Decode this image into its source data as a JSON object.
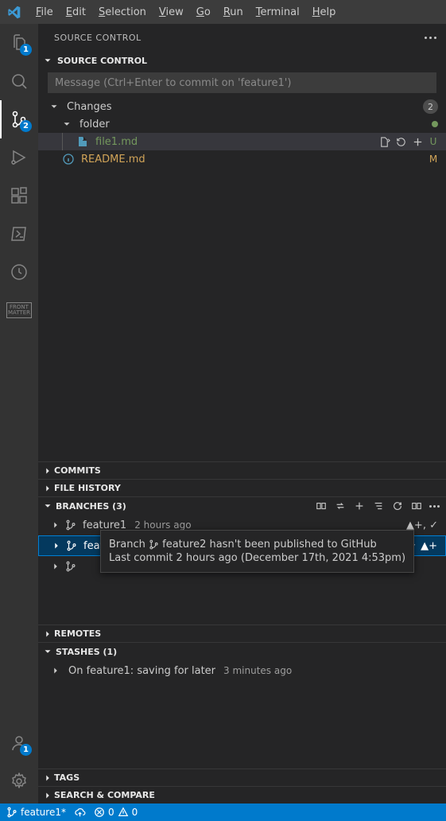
{
  "menu": {
    "file": "File",
    "edit": "Edit",
    "selection": "Selection",
    "view": "View",
    "go": "Go",
    "run": "Run",
    "terminal": "Terminal",
    "help": "Help"
  },
  "activitybar": {
    "explorer_badge": "1",
    "scm_badge": "2",
    "accounts_badge": "1",
    "front_top": "FRONT",
    "front_bot": "MATTER"
  },
  "view": {
    "title": "SOURCE CONTROL",
    "repo_header": "SOURCE CONTROL",
    "commit_placeholder": "Message (Ctrl+Enter to commit on 'feature1')",
    "changes": {
      "label": "Changes",
      "count": "2",
      "folder": "folder",
      "file1": "file1.md",
      "file1_status": "U",
      "file2": "README.md",
      "file2_status": "M"
    },
    "commits": "COMMITS",
    "file_history": "FILE HISTORY",
    "branches": {
      "label": "BRANCHES (3)",
      "items": [
        {
          "name": "feature1",
          "ago": "2 hours ago",
          "indicator": "▲+, ✓"
        },
        {
          "name": "feature2",
          "ago": "2 hours ago",
          "indicator": "▲+"
        }
      ]
    },
    "remotes": "REMOTES",
    "stashes": {
      "label": "STASHES (1)",
      "item": "On feature1: saving for later",
      "ago": "3 minutes ago"
    },
    "tags": "TAGS",
    "search": "SEARCH & COMPARE"
  },
  "tooltip": {
    "line1_a": "Branch ",
    "line1_b": " feature2 hasn't been published to GitHub",
    "line2": "Last commit 2 hours ago (December 17th, 2021 4:53pm)"
  },
  "statusbar": {
    "branch": "feature1*",
    "errors": "0",
    "warnings": "0"
  }
}
